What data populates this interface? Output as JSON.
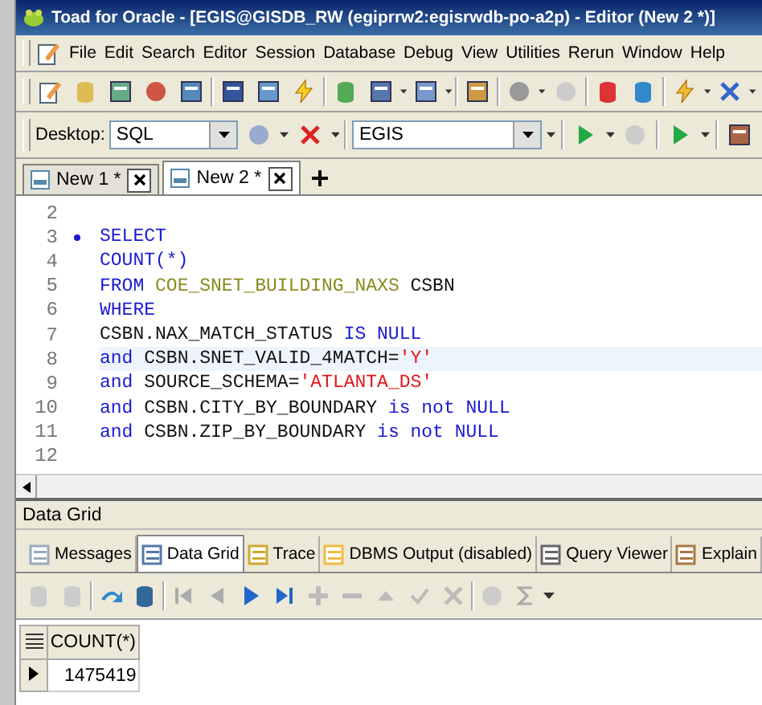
{
  "window": {
    "title": "Toad for Oracle - [EGIS@GISDB_RW (egiprrw2:egisrwdb-po-a2p) - Editor (New 2 *)]"
  },
  "menu": [
    "File",
    "Edit",
    "Search",
    "Editor",
    "Session",
    "Database",
    "Debug",
    "View",
    "Utilities",
    "Rerun",
    "Window",
    "Help"
  ],
  "desktop_bar": {
    "label": "Desktop:",
    "desktop": "SQL",
    "schema": "EGIS"
  },
  "editor_tabs": [
    {
      "label": "New 1 *",
      "selected": false
    },
    {
      "label": "New 2 *",
      "selected": true
    }
  ],
  "editor": {
    "lines": [
      {
        "number": "2",
        "marker": false,
        "current": false
      },
      {
        "number": "3",
        "marker": true,
        "current": false,
        "tokens": [
          {
            "kind": "kw",
            "text": "SELECT"
          }
        ]
      },
      {
        "number": "4",
        "marker": false,
        "current": false,
        "tokens": [
          {
            "kind": "kw",
            "text": "COUNT(*)"
          }
        ]
      },
      {
        "number": "5",
        "marker": false,
        "current": false,
        "tokens": [
          {
            "kind": "kw",
            "text": "FROM "
          },
          {
            "kind": "table",
            "text": "COE_SNET_BUILDING_NAXS"
          },
          {
            "kind": "ident",
            "text": " CSBN"
          }
        ]
      },
      {
        "number": "6",
        "marker": false,
        "current": false,
        "tokens": [
          {
            "kind": "kw",
            "text": "WHERE"
          }
        ]
      },
      {
        "number": "7",
        "marker": false,
        "current": false,
        "tokens": [
          {
            "kind": "ident",
            "text": "CSBN.NAX_MATCH_STATUS "
          },
          {
            "kind": "kw",
            "text": "IS NULL"
          }
        ]
      },
      {
        "number": "8",
        "marker": false,
        "current": true,
        "tokens": [
          {
            "kind": "kw",
            "text": "and "
          },
          {
            "kind": "ident",
            "text": "CSBN.SNET_VALID_4MATCH="
          },
          {
            "kind": "str",
            "text": "'Y'"
          }
        ]
      },
      {
        "number": "9",
        "marker": false,
        "current": false,
        "tokens": [
          {
            "kind": "kw",
            "text": "and "
          },
          {
            "kind": "ident",
            "text": "SOURCE_SCHEMA="
          },
          {
            "kind": "str",
            "text": "'ATLANTA_DS'"
          }
        ]
      },
      {
        "number": "10",
        "marker": false,
        "current": false,
        "tokens": [
          {
            "kind": "kw",
            "text": "and "
          },
          {
            "kind": "ident",
            "text": "CSBN.CITY_BY_BOUNDARY "
          },
          {
            "kind": "kw",
            "text": "is not NULL"
          }
        ]
      },
      {
        "number": "11",
        "marker": false,
        "current": false,
        "tokens": [
          {
            "kind": "kw",
            "text": "and "
          },
          {
            "kind": "ident",
            "text": "CSBN.ZIP_BY_BOUNDARY "
          },
          {
            "kind": "kw",
            "text": "is not NULL"
          }
        ]
      },
      {
        "number": "12",
        "marker": false,
        "current": false
      }
    ]
  },
  "results": {
    "title": "Data Grid",
    "tabs": [
      {
        "label": "Messages",
        "selected": false
      },
      {
        "label": "Data Grid",
        "selected": true
      },
      {
        "label": "Trace",
        "selected": false
      },
      {
        "label": "DBMS Output (disabled)",
        "selected": false
      },
      {
        "label": "Query Viewer",
        "selected": false
      },
      {
        "label": "Explain",
        "selected": false
      }
    ],
    "grid": {
      "columns": [
        "COUNT(*)"
      ],
      "rows": [
        {
          "current": true,
          "cells": [
            "1475419"
          ]
        }
      ]
    }
  }
}
